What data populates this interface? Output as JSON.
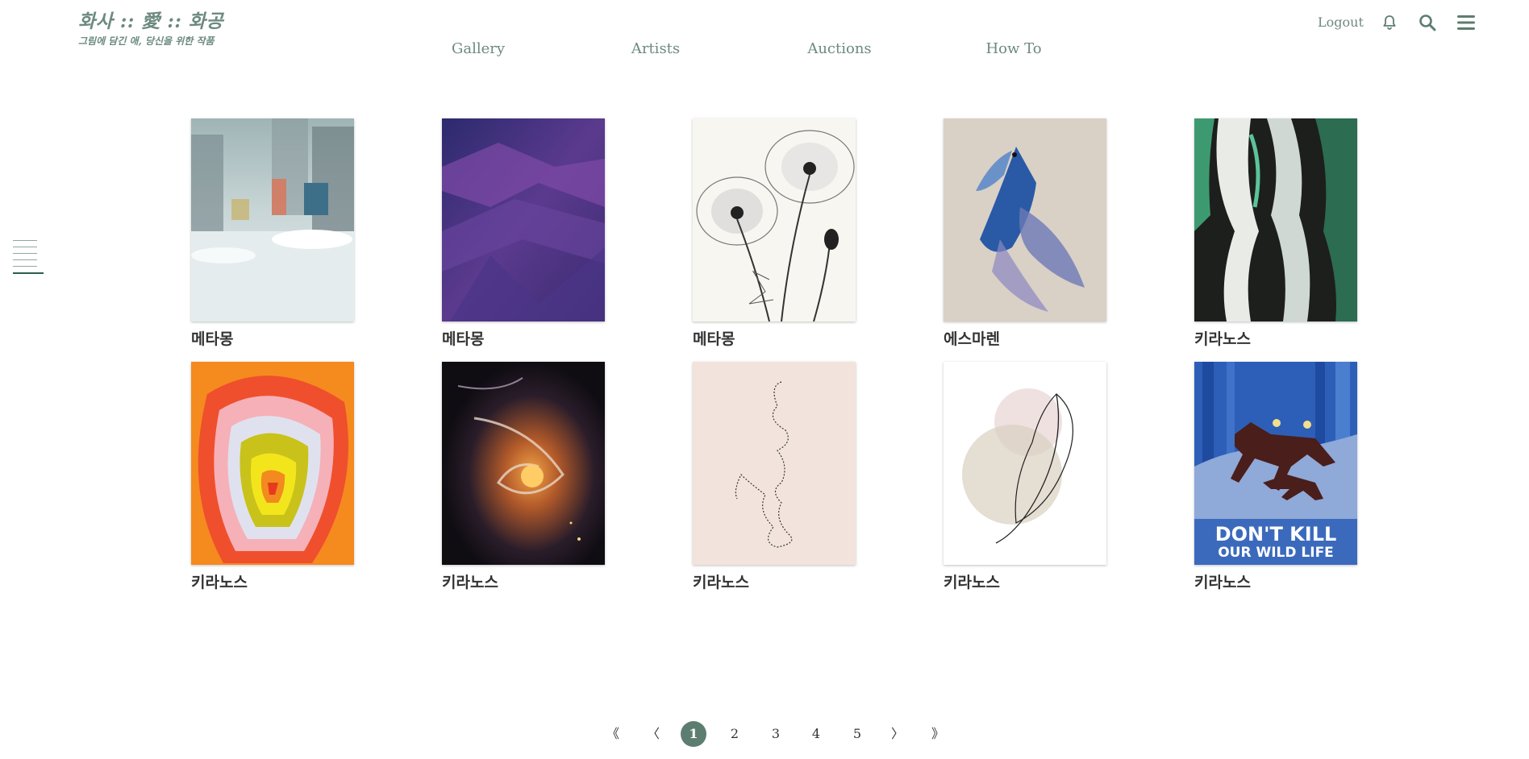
{
  "header": {
    "brand_title": "화사 :: 愛 :: 화공",
    "brand_subtitle": "그림에 담긴 애, 당신을 위한 작품",
    "logout_label": "Logout",
    "icons": [
      "bell-icon",
      "search-icon",
      "menu-icon"
    ]
  },
  "nav": {
    "items": [
      {
        "label": "Gallery"
      },
      {
        "label": "Artists"
      },
      {
        "label": "Auctions"
      },
      {
        "label": "How To"
      }
    ]
  },
  "gallery": {
    "items": [
      {
        "artist": "메타몽",
        "art": "snowy-city-street"
      },
      {
        "artist": "메타몽",
        "art": "purple-brush-texture"
      },
      {
        "artist": "메타몽",
        "art": "xray-poppies"
      },
      {
        "artist": "에스마렌",
        "art": "blue-betta-fish"
      },
      {
        "artist": "키라노스",
        "art": "green-black-paint-flow"
      },
      {
        "artist": "키라노스",
        "art": "concentric-color-rings"
      },
      {
        "artist": "키라노스",
        "art": "orange-cosmic-swirl"
      },
      {
        "artist": "키라노스",
        "art": "line-drawing-on-pink"
      },
      {
        "artist": "키라노스",
        "art": "leaf-line-art"
      },
      {
        "artist": "키라노스",
        "art": "dont-kill-our-wild-life-poster",
        "poster_text": [
          "DON'T KILL",
          "OUR WILD LIFE"
        ]
      }
    ]
  },
  "pagination": {
    "first": "《",
    "prev": "〈",
    "pages": [
      "1",
      "2",
      "3",
      "4",
      "5"
    ],
    "current": "1",
    "next": "〉",
    "last": "》"
  },
  "colors": {
    "accent": "#5e7d71",
    "brand_text": "#6c8a80",
    "side_active": "#2e5d50"
  }
}
